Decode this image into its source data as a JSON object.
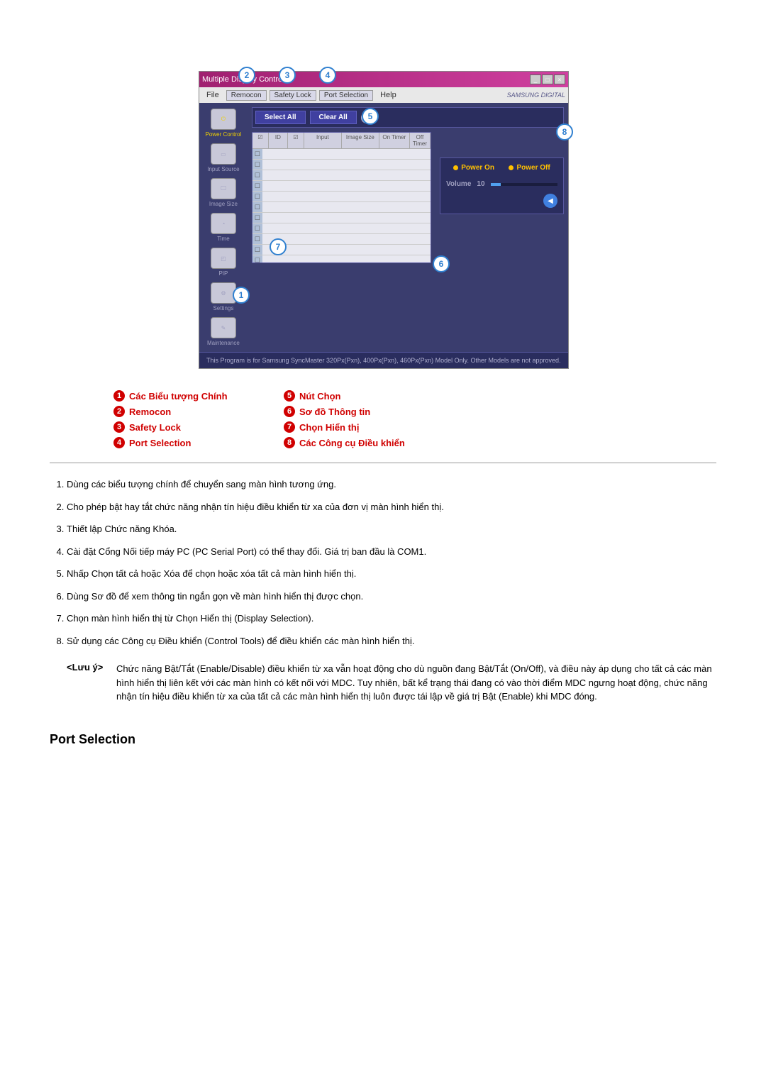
{
  "app": {
    "title": "Multiple Display Control",
    "menubar": {
      "file": "File",
      "remocon": "Remocon",
      "safety_lock": "Safety Lock",
      "port_selection": "Port Selection",
      "help": "Help"
    },
    "brand": "SAMSUNG DIGITAL",
    "sidebar": {
      "power_control": "Power Control",
      "input_source": "Input Source",
      "image_size": "Image Size",
      "time": "Time",
      "pip": "PIP",
      "settings": "Settings",
      "maintenance": "Maintenance"
    },
    "actions": {
      "select_all": "Select All",
      "clear_all": "Clear All"
    },
    "grid_headers": {
      "chk": "",
      "id": "ID",
      "input": "Input",
      "image_size": "Image Size",
      "on_timer": "On Timer",
      "off_timer": "Off Timer"
    },
    "controls": {
      "power_on": "Power On",
      "power_off": "Power Off",
      "volume_label": "Volume",
      "volume_value": "10"
    },
    "footer": "This Program is for Samsung SyncMaster 320Px(Pxn), 400Px(Pxn), 460Px(Pxn)  Model Only. Other Models are not approved."
  },
  "callouts": {
    "c1": "1",
    "c2": "2",
    "c3": "3",
    "c4": "4",
    "c5": "5",
    "c6": "6",
    "c7": "7",
    "c8": "8"
  },
  "legend": {
    "i1": "Các Biểu tượng Chính",
    "i2": "Remocon",
    "i3": "Safety Lock",
    "i4": "Port Selection",
    "i5": "Nút Chọn",
    "i6": "Sơ đồ Thông tin",
    "i7": "Chọn Hiển thị",
    "i8": "Các Công cụ Điều khiển"
  },
  "descriptions": {
    "d1": "Dùng các biểu tượng chính để chuyển sang màn hình tương ứng.",
    "d2": "Cho phép bật hay tắt chức năng nhận tín hiệu điều khiển từ xa của đơn vị màn hình hiển thị.",
    "d3": "Thiết lập Chức năng Khóa.",
    "d4": "Cài đặt Cổng Nối tiếp máy PC (PC Serial Port) có thể thay đổi. Giá trị ban đầu là COM1.",
    "d5": "Nhấp Chọn tất cả hoặc Xóa để chọn hoặc xóa tất cả màn hình hiển thị.",
    "d6": "Dùng Sơ đồ để xem thông tin ngắn gọn về màn hình hiển thị được chọn.",
    "d7": "Chọn màn hình hiển thị từ Chọn Hiển thị (Display Selection).",
    "d8": "Sử dụng các Công cụ Điều khiển (Control Tools) để điều khiển các màn hình hiển thị."
  },
  "note": {
    "label": "<Lưu ý>",
    "body": "Chức năng Bật/Tắt (Enable/Disable) điều khiển từ xa vẫn hoạt động cho dù nguồn đang Bật/Tắt (On/Off), và điều này áp dụng cho tất cả các màn hình hiển thị liên kết với các màn hình có kết nối với MDC. Tuy nhiên, bất kể trạng thái đang có vào thời điểm MDC ngưng hoạt động, chức năng nhận tín hiệu điều khiển từ xa của tất cả các màn hình hiển thị luôn được tái lập về giá trị Bật (Enable) khi MDC đóng."
  },
  "section_title": "Port Selection"
}
